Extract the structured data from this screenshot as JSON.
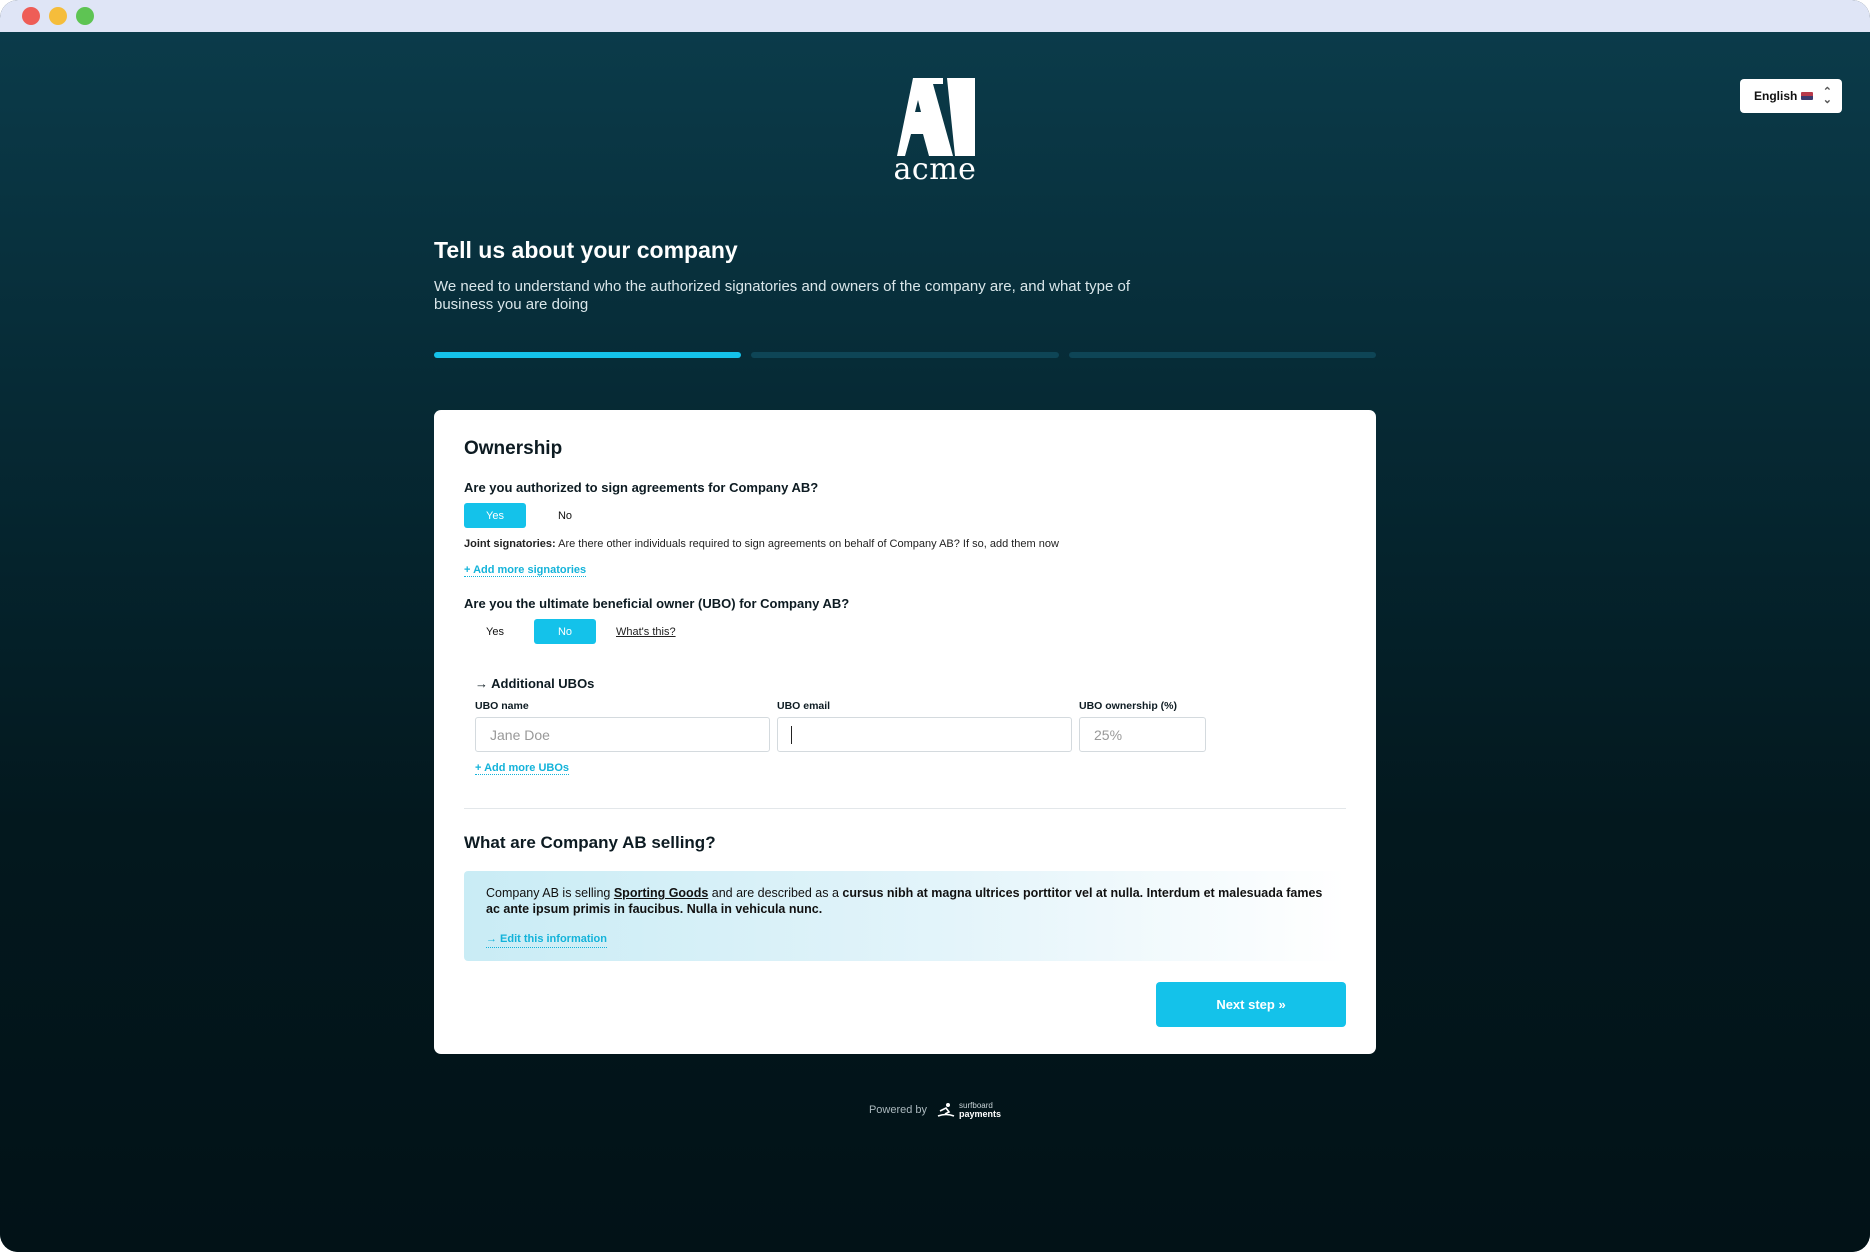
{
  "window": {
    "controls": [
      "close",
      "minimize",
      "maximize"
    ]
  },
  "language_select": {
    "value": "English",
    "flag_icon": "us-flag-icon"
  },
  "brand": {
    "name": "acme"
  },
  "hero": {
    "title": "Tell us about your company",
    "description": "We need to understand who the authorized signatories and owners of the company are, and what type of business you are doing"
  },
  "progress": {
    "steps_total": 3,
    "current_step": 1
  },
  "ownership": {
    "heading": "Ownership",
    "q_authorized": "Are you authorized to sign agreements for Company AB?",
    "yes_label": "Yes",
    "no_label": "No",
    "authorized_selected": "Yes",
    "joint_label": "Joint signatories:",
    "joint_text": " Are there other individuals required to sign agreements on behalf of Company AB? If so, add them now",
    "add_signatories": "+ Add more signatories",
    "q_ubo": "Are you the ultimate beneficial owner (UBO) for Company AB?",
    "ubo_selected": "No",
    "whats_this": "What's this?"
  },
  "ubos": {
    "heading": "→ Additional UBOs",
    "name_label": "UBO name",
    "name_placeholder": "Jane Doe",
    "email_label": "UBO email",
    "email_value": "",
    "ownership_label": "UBO ownership (%)",
    "ownership_placeholder": "25%",
    "add_more": "+ Add more UBOs"
  },
  "selling": {
    "heading": "What are Company AB selling?",
    "intro": "Company AB is selling ",
    "category": "Sporting Goods",
    "mid": " and are described as a ",
    "description": "cursus nibh at magna ultrices porttitor vel at nulla. Interdum et malesuada fames ac ante ipsum primis in faucibus. Nulla in vehicula nunc.",
    "edit_link": "→ Edit this information"
  },
  "actions": {
    "next_label": "Next step »"
  },
  "footer": {
    "powered_by": "Powered by",
    "partner_top": "surfboard",
    "partner_bottom": "payments"
  },
  "colors": {
    "accent": "#14c2ea",
    "bg_top": "#0b3b4a",
    "bg_bottom": "#021217"
  }
}
